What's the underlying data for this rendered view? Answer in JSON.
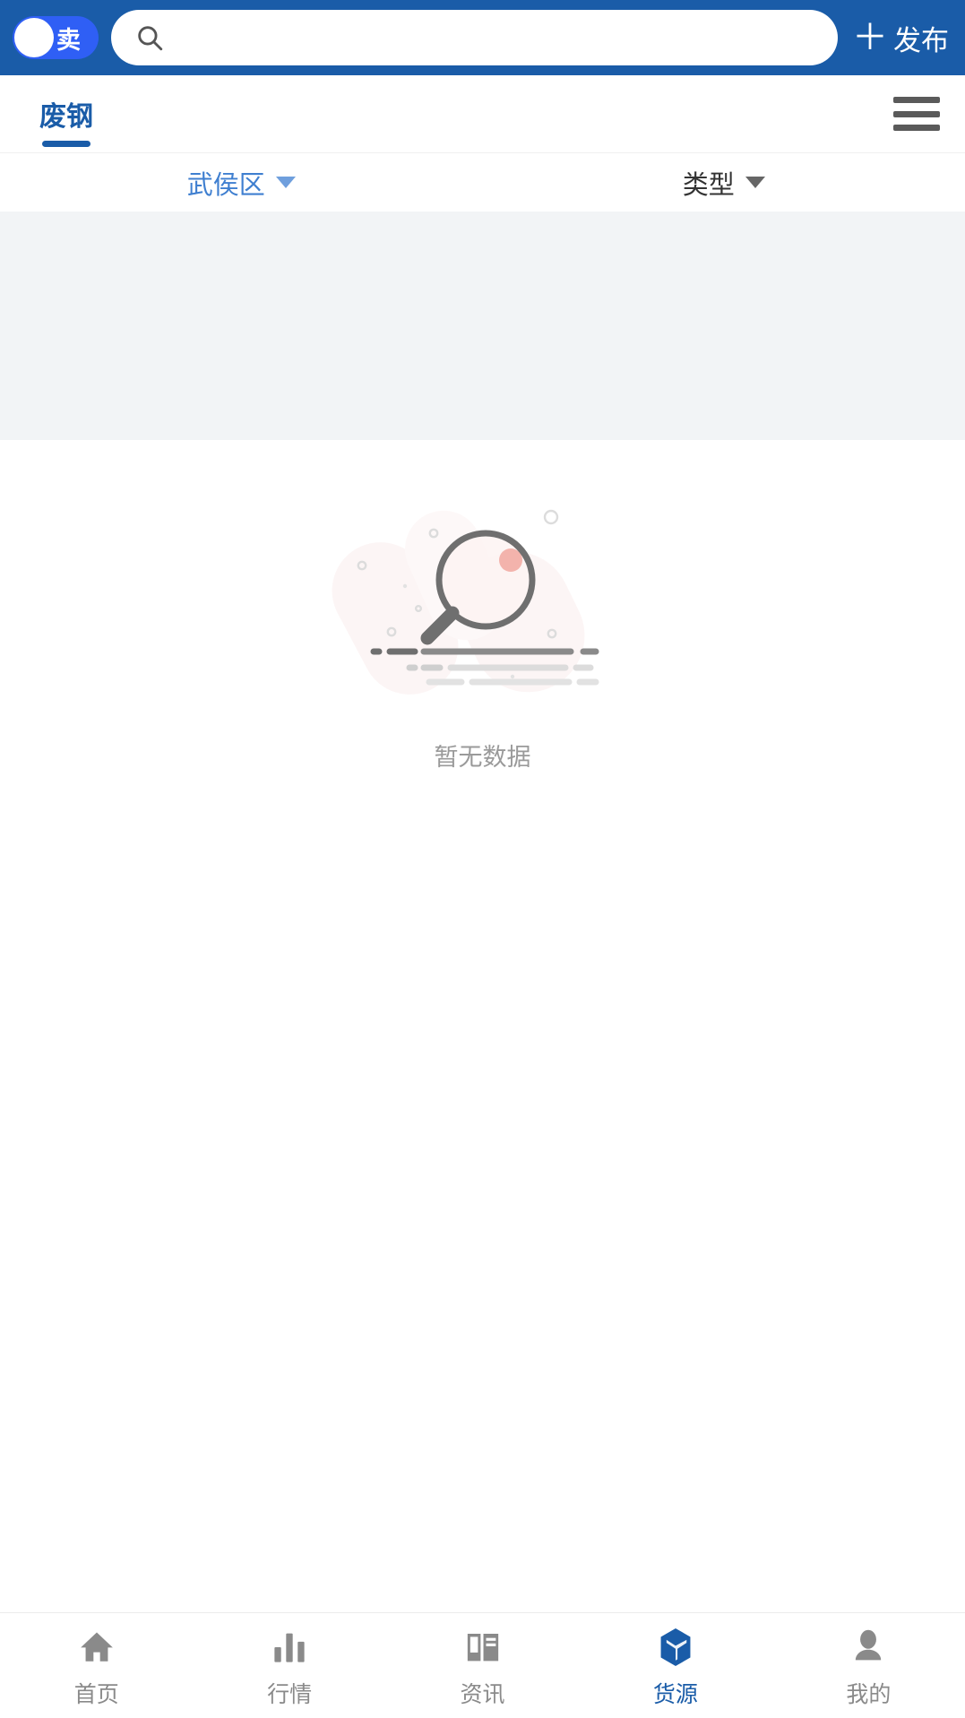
{
  "topbar": {
    "toggle": {
      "label": "卖",
      "state": "on",
      "icon": "toggle-knob"
    },
    "search": {
      "value": "",
      "placeholder": "",
      "icon": "search-icon"
    },
    "publish": {
      "plus": "＋",
      "label": "发布"
    },
    "background_color": "#1a5ca8"
  },
  "tabbar": {
    "tabs": [
      {
        "label": "废钢",
        "active": true
      }
    ],
    "menu_icon": "hamburger-menu-icon",
    "active_color": "#1a5ca8"
  },
  "filters": [
    {
      "label": "武侯区",
      "selected": true,
      "icon": "chevron-down-icon"
    },
    {
      "label": "类型",
      "selected": false,
      "icon": "chevron-down-icon"
    }
  ],
  "banner": {
    "color": "#f2f4f6"
  },
  "empty_state": {
    "icon": "magnifier-no-data-illustration",
    "text": "暂无数据"
  },
  "bottom_nav": {
    "items": [
      {
        "label": "首页",
        "icon": "home-icon",
        "active": false
      },
      {
        "label": "行情",
        "icon": "bar-chart-icon",
        "active": false
      },
      {
        "label": "资讯",
        "icon": "book-news-icon",
        "active": false
      },
      {
        "label": "货源",
        "icon": "box-cube-icon",
        "active": true
      },
      {
        "label": "我的",
        "icon": "user-profile-icon",
        "active": false
      }
    ],
    "active_color": "#1a5ca8",
    "inactive_color": "#8a8a8a"
  }
}
